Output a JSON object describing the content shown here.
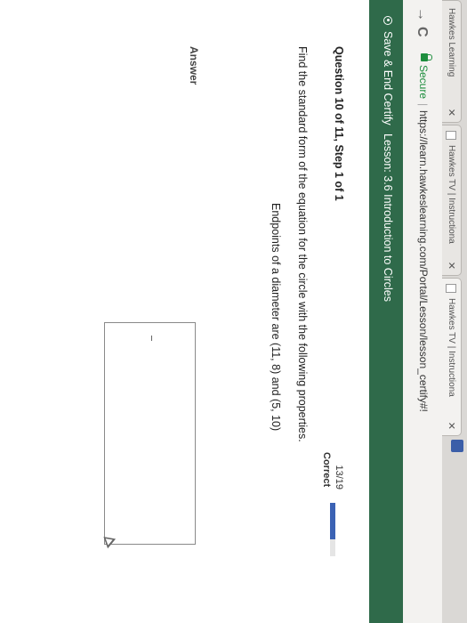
{
  "browser": {
    "tabs": [
      {
        "label": "Hawkes Learning"
      },
      {
        "label": "Hawkes TV | Instructiona"
      },
      {
        "label": "Hawkes TV | Instructiona"
      }
    ],
    "secure_label": "Secure",
    "url": "https://learn.hawkeslearning.com/Portal/Lesson/lesson_certify#!"
  },
  "toolbar": {
    "save_label": "Save & End Certify",
    "lesson_title": "Lesson: 3.6 Introduction to Circles"
  },
  "question": {
    "header": "Question 10 of 11, Step 1 of 1",
    "score": "13/19",
    "status": "Correct",
    "progress_fraction": 0.68,
    "prompt": "Find the standard form of the equation for the circle with the following properties.",
    "properties": "Endpoints of a diameter are (11, 8) and (5, 10)"
  },
  "answer": {
    "label": "Answer",
    "value": ""
  },
  "colors": {
    "toolbar_bg": "#2f6a4a",
    "progress_fill": "#3b62b4",
    "secure_green": "#1e8e3e"
  }
}
